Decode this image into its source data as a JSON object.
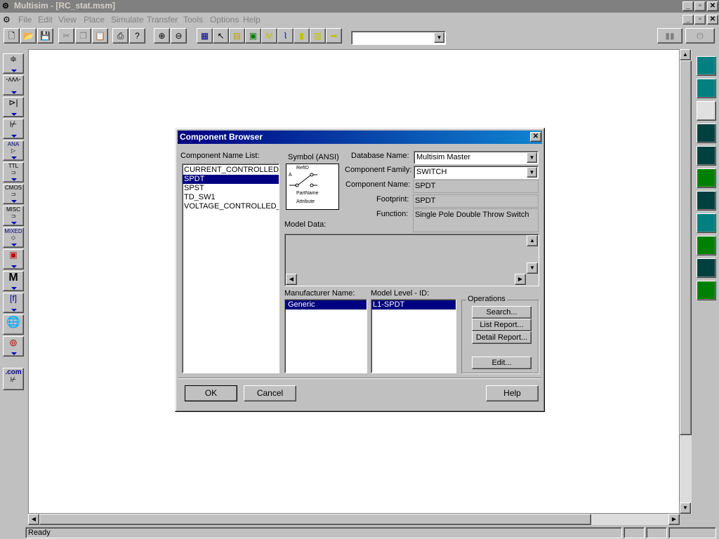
{
  "window": {
    "title": "Multisim - [RC_stat.msm]"
  },
  "menu": [
    "File",
    "Edit",
    "View",
    "Place",
    "Simulate",
    "Transfer",
    "Tools",
    "Options",
    "Help"
  ],
  "status": {
    "text": "Ready"
  },
  "left_toolbar": {
    "labels": [
      "ANA",
      "TTL",
      "CMOS",
      "MISC",
      "MIXED",
      "M",
      ".com"
    ]
  },
  "dialog": {
    "title": "Component Browser",
    "component_name_list_label": "Component Name List:",
    "component_names": [
      "CURRENT_CONTROLLED",
      "SPDT",
      "SPST",
      "TD_SW1",
      "VOLTAGE_CONTROLLED_"
    ],
    "symbol_label": "Symbol (ANSI)",
    "symbol_text": {
      "refid": "RefID",
      "a": "A",
      "partname": "PartName",
      "attribute": "Attribute"
    },
    "database_name_label": "Database Name:",
    "database_name": "Multisim Master",
    "component_family_label": "Component Family:",
    "component_family": "SWITCH",
    "component_name_label": "Component Name:",
    "component_name": "SPDT",
    "footprint_label": "Footprint:",
    "footprint": "SPDT",
    "function_label": "Function:",
    "function": "Single Pole Double Throw Switch",
    "model_data_label": "Model Data:",
    "manufacturer_name_label": "Manufacturer Name:",
    "manufacturer": "Generic",
    "model_level_label": "Model Level - ID:",
    "model_level": "L1-SPDT",
    "operations_label": "Operations",
    "search_label": "Search...",
    "list_report_label": "List Report...",
    "detail_report_label": "Detail Report...",
    "edit_label": "Edit...",
    "ok_label": "OK",
    "cancel_label": "Cancel",
    "help_label": "Help"
  }
}
